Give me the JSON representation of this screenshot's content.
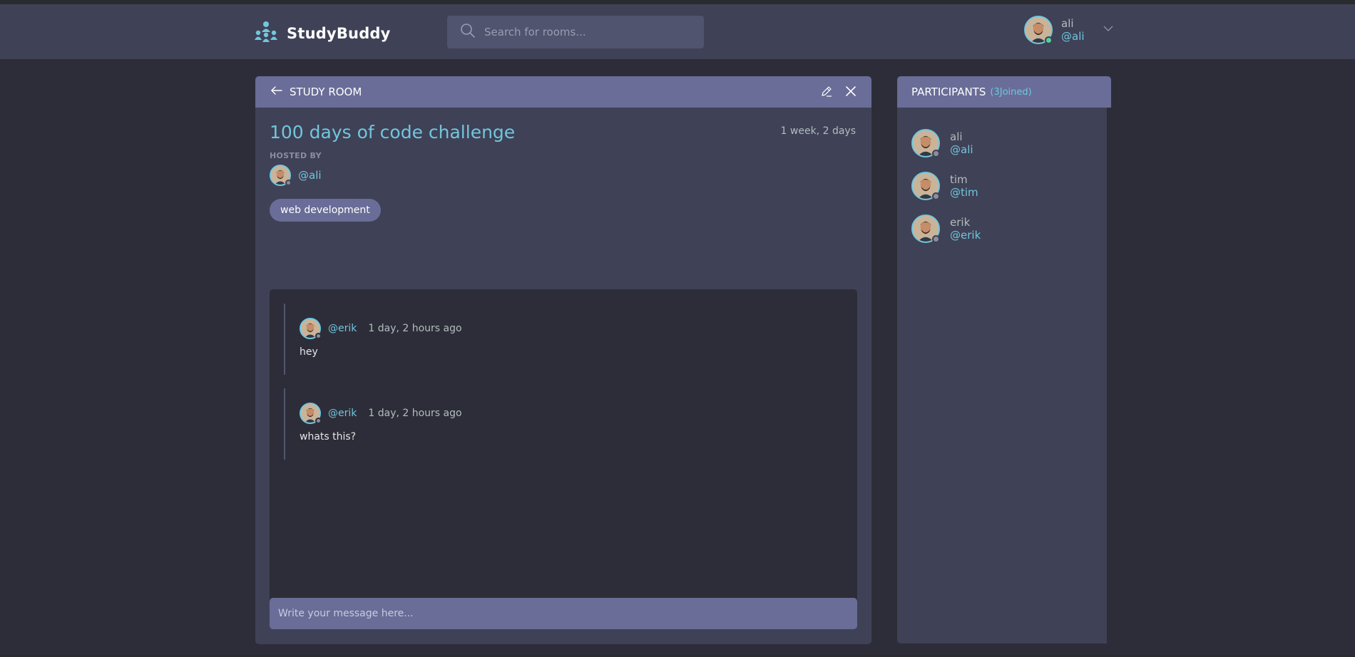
{
  "app": {
    "name": "StudyBuddy"
  },
  "search": {
    "placeholder": "Search for rooms..."
  },
  "user": {
    "name": "ali",
    "handle": "@ali"
  },
  "room": {
    "header_title": "STUDY ROOM",
    "title": "100 days of code challenge",
    "time_since": "1 week, 2 days",
    "hosted_by_label": "HOSTED BY",
    "host_handle": "@ali",
    "topic": "web development",
    "messages": [
      {
        "handle": "@erik",
        "time": "1 day, 2 hours ago",
        "body": "hey"
      },
      {
        "handle": "@erik",
        "time": "1 day, 2 hours ago",
        "body": "whats this?"
      }
    ],
    "message_placeholder": "Write your message here..."
  },
  "participants": {
    "title": "PARTICIPANTS",
    "count_label": "(3Joined)",
    "list": [
      {
        "name": "ali",
        "handle": "@ali"
      },
      {
        "name": "tim",
        "handle": "@tim"
      },
      {
        "name": "erik",
        "handle": "@erik"
      }
    ]
  },
  "colors": {
    "background": "#2d2d39",
    "panel": "#3f4156",
    "panel_header": "#696d97",
    "accent": "#71c6dd",
    "online": "#4fd39b"
  },
  "icons": [
    "logo-icon",
    "search-icon",
    "chevron-down-icon",
    "back-arrow-icon",
    "edit-icon",
    "close-icon"
  ]
}
